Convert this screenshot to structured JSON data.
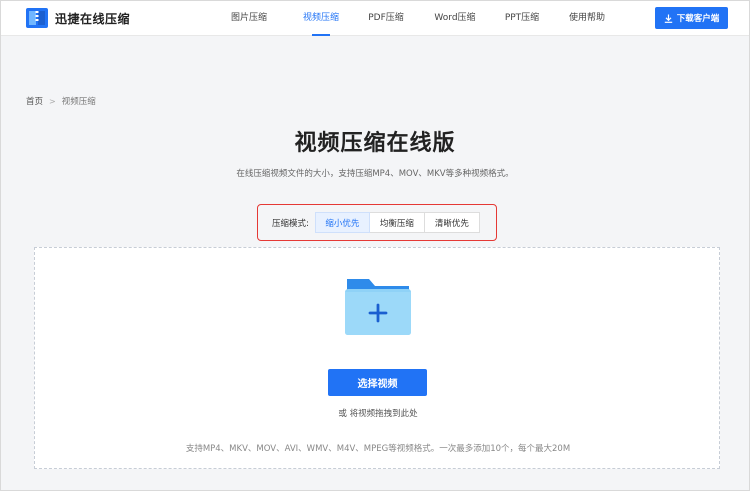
{
  "header": {
    "logo_text": "迅捷在线压缩",
    "nav": [
      {
        "label": "图片压缩",
        "active": false
      },
      {
        "label": "视频压缩",
        "active": true
      },
      {
        "label": "PDF压缩",
        "active": false
      },
      {
        "label": "Word压缩",
        "active": false
      },
      {
        "label": "PPT压缩",
        "active": false
      },
      {
        "label": "使用帮助",
        "active": false
      }
    ],
    "download_label": "下载客户端"
  },
  "breadcrumb": {
    "home": "首页",
    "separator": ">",
    "current": "视频压缩"
  },
  "main": {
    "title": "视频压缩在线版",
    "subtitle": "在线压缩视频文件的大小，支持压缩MP4、MOV、MKV等多种视频格式。"
  },
  "mode": {
    "label": "压缩模式:",
    "options": [
      {
        "label": "缩小优先",
        "active": true
      },
      {
        "label": "均衡压缩",
        "active": false
      },
      {
        "label": "清晰优先",
        "active": false
      }
    ],
    "highlight_color": "#e53935"
  },
  "upload": {
    "select_label": "选择视频",
    "drag_hint": "或 将视频拖拽到此处",
    "formats_hint": "支持MP4、MKV、MOV、AVI、WMV、M4V、MPEG等视频格式。一次最多添加10个，每个最大20M"
  },
  "colors": {
    "accent": "#2173f5",
    "folder_light": "#8fd2f7",
    "folder_dark": "#2e8bea"
  }
}
